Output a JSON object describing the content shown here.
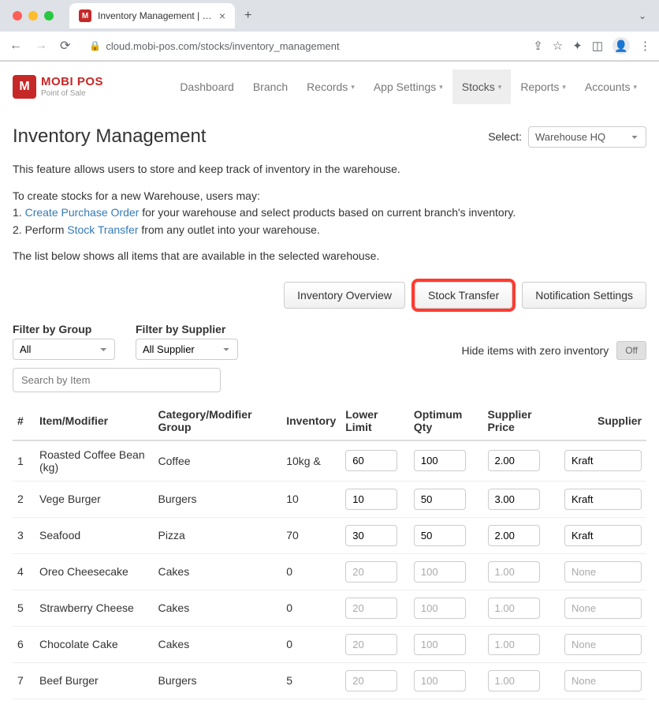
{
  "browser": {
    "tab_title": "Inventory Management | MobiP",
    "url": "cloud.mobi-pos.com/stocks/inventory_management"
  },
  "brand": {
    "badge": "M",
    "name": "MOBI POS",
    "tagline": "Point of Sale"
  },
  "nav": {
    "items": [
      {
        "label": "Dashboard",
        "dropdown": false,
        "active": false
      },
      {
        "label": "Branch",
        "dropdown": false,
        "active": false
      },
      {
        "label": "Records",
        "dropdown": true,
        "active": false
      },
      {
        "label": "App Settings",
        "dropdown": true,
        "active": false
      },
      {
        "label": "Stocks",
        "dropdown": true,
        "active": true
      },
      {
        "label": "Reports",
        "dropdown": true,
        "active": false
      },
      {
        "label": "Accounts",
        "dropdown": true,
        "active": false
      }
    ]
  },
  "page": {
    "title": "Inventory Management",
    "select_label": "Select:",
    "warehouse_value": "Warehouse HQ",
    "intro_p1": "This feature allows users to store and keep track of inventory in the warehouse.",
    "intro_p2_lead": "To create stocks for a new Warehouse, users may:",
    "intro_li1_pre": "1. ",
    "intro_li1_link": "Create Purchase Order",
    "intro_li1_post": " for your warehouse and select products based on current branch's inventory.",
    "intro_li2_pre": "2. Perform ",
    "intro_li2_link": "Stock Transfer",
    "intro_li2_post": " from any outlet into your warehouse.",
    "intro_p3": "The list below shows all items that are available in the selected warehouse."
  },
  "actions": {
    "inventory_overview": "Inventory Overview",
    "stock_transfer": "Stock Transfer",
    "notification_settings": "Notification Settings"
  },
  "filters": {
    "group_label": "Filter by Group",
    "group_value": "All",
    "supplier_label": "Filter by Supplier",
    "supplier_value": "All Supplier",
    "hide_zero_label": "Hide items with zero inventory",
    "hide_zero_state": "Off",
    "search_placeholder": "Search by Item"
  },
  "table": {
    "headers": {
      "num": "#",
      "item": "Item/Modifier",
      "category": "Category/Modifier Group",
      "inventory": "Inventory",
      "lower_limit": "Lower Limit",
      "optimum_qty": "Optimum Qty",
      "supplier_price": "Supplier Price",
      "supplier": "Supplier"
    },
    "rows": [
      {
        "num": "1",
        "item": "Roasted Coffee Bean (kg)",
        "category": "Coffee",
        "inventory": "10kg &",
        "lower_limit": "60",
        "optimum_qty": "100",
        "supplier_price": "2.00",
        "supplier": "Kraft",
        "enabled": true
      },
      {
        "num": "2",
        "item": "Vege Burger",
        "category": "Burgers",
        "inventory": "10",
        "lower_limit": "10",
        "optimum_qty": "50",
        "supplier_price": "3.00",
        "supplier": "Kraft",
        "enabled": true
      },
      {
        "num": "3",
        "item": "Seafood",
        "category": "Pizza",
        "inventory": "70",
        "lower_limit": "30",
        "optimum_qty": "50",
        "supplier_price": "2.00",
        "supplier": "Kraft",
        "enabled": true
      },
      {
        "num": "4",
        "item": "Oreo Cheesecake",
        "category": "Cakes",
        "inventory": "0",
        "lower_limit": "20",
        "optimum_qty": "100",
        "supplier_price": "1.00",
        "supplier": "None",
        "enabled": false
      },
      {
        "num": "5",
        "item": "Strawberry Cheese",
        "category": "Cakes",
        "inventory": "0",
        "lower_limit": "20",
        "optimum_qty": "100",
        "supplier_price": "1.00",
        "supplier": "None",
        "enabled": false
      },
      {
        "num": "6",
        "item": "Chocolate Cake",
        "category": "Cakes",
        "inventory": "0",
        "lower_limit": "20",
        "optimum_qty": "100",
        "supplier_price": "1.00",
        "supplier": "None",
        "enabled": false
      },
      {
        "num": "7",
        "item": "Beef Burger",
        "category": "Burgers",
        "inventory": "5",
        "lower_limit": "20",
        "optimum_qty": "100",
        "supplier_price": "1.00",
        "supplier": "None",
        "enabled": false
      }
    ]
  }
}
